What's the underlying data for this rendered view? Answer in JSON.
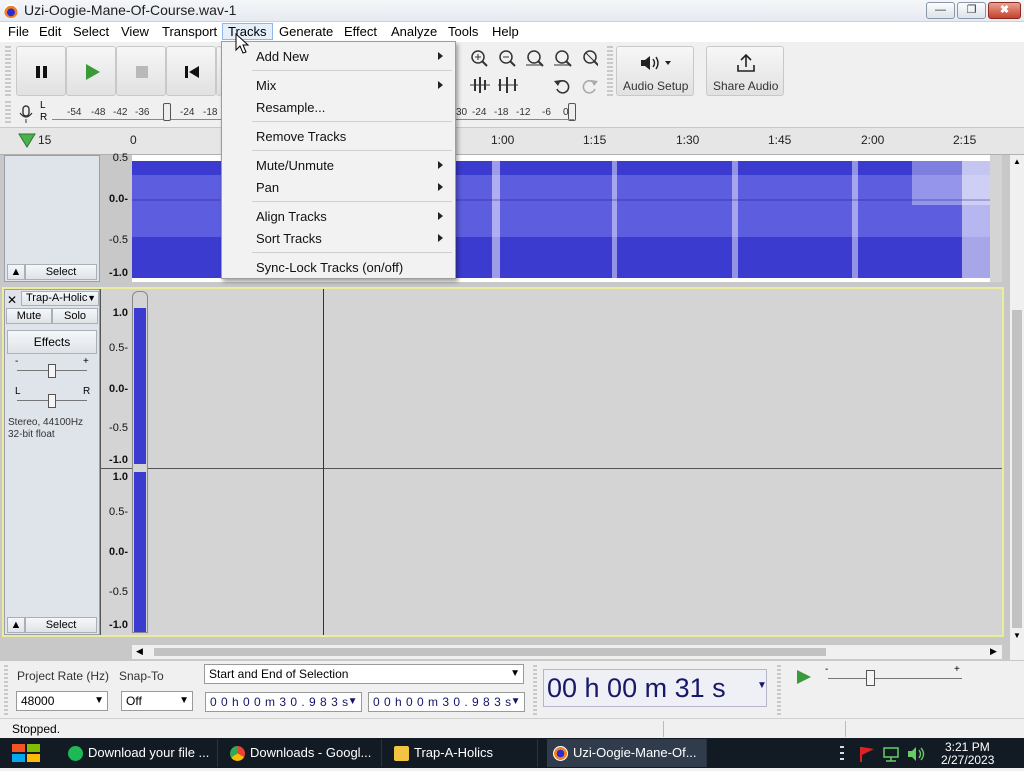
{
  "window": {
    "title": "Uzi-Oogie-Mane-Of-Course.wav-1",
    "minimize": "—",
    "restore": "❐",
    "close": "✖"
  },
  "menubar": [
    "File",
    "Edit",
    "Select",
    "View",
    "Transport",
    "Tracks",
    "Generate",
    "Effect",
    "Analyze",
    "Tools",
    "Help"
  ],
  "menubar_active": "Tracks",
  "tracks_menu": {
    "items": [
      {
        "label": "Add New",
        "submenu": true
      },
      {
        "label": "Mix",
        "submenu": true
      },
      {
        "label": "Resample...",
        "submenu": false
      },
      {
        "label": "Remove Tracks",
        "submenu": false
      },
      {
        "label": "Mute/Unmute",
        "submenu": true
      },
      {
        "label": "Pan",
        "submenu": true
      },
      {
        "label": "Align Tracks",
        "submenu": true
      },
      {
        "label": "Sort Tracks",
        "submenu": true
      },
      {
        "label": "Sync-Lock Tracks (on/off)",
        "submenu": false
      }
    ]
  },
  "toolbar": {
    "audio_setup": "Audio Setup",
    "share_audio": "Share Audio"
  },
  "meters": {
    "L": "L",
    "R": "R",
    "left_ticks": [
      "-54",
      "-48",
      "-42",
      "-36",
      "-24",
      "-18"
    ],
    "right_ticks": [
      "30",
      "-24",
      "-18",
      "-12",
      "-6",
      "0"
    ]
  },
  "ruler": {
    "labels": [
      "15",
      "0",
      "1:00",
      "1:15",
      "1:30",
      "1:45",
      "2:00",
      "2:15"
    ]
  },
  "track1": {
    "select": "Select",
    "scale": [
      "0.5",
      "0.0-",
      "-0.5",
      "-1.0"
    ]
  },
  "track2": {
    "name": "Trap-A-Holic",
    "mute": "Mute",
    "solo": "Solo",
    "effects": "Effects",
    "gain_minus": "-",
    "gain_plus": "+",
    "pan_l": "L",
    "pan_r": "R",
    "info1": "Stereo, 44100Hz",
    "info2": "32-bit float",
    "select": "Select",
    "scale_top": [
      "1.0",
      "0.5-",
      "0.0-",
      "-0.5",
      "-1.0"
    ],
    "scale_bottom": [
      "1.0",
      "0.5-",
      "0.0-",
      "-0.5",
      "-1.0"
    ]
  },
  "bottom": {
    "project_rate_label": "Project Rate (Hz)",
    "project_rate": "48000",
    "snap_label": "Snap-To",
    "snap": "Off",
    "selection_mode": "Start and End of Selection",
    "sel_start": "0 0 h 0 0 m 3 0 . 9 8 3 s",
    "sel_end": "0 0 h 0 0 m 3 0 . 9 8 3 s",
    "time_display": "00 h 00 m 31 s",
    "speed_minus": "-",
    "speed_plus": "+"
  },
  "status": "Stopped.",
  "taskbar": {
    "tasks": [
      "Download your file ...",
      "Downloads - Googl...",
      "Trap-A-Holics",
      "Uzi-Oogie-Mane-Of..."
    ],
    "time": "3:21 PM",
    "date": "2/27/2023"
  },
  "colors": {
    "waveform": "#3030c8",
    "waveform_light": "#6b6be0",
    "track_bg": "#d4d4d4",
    "selection_bg": "#ffffff"
  }
}
